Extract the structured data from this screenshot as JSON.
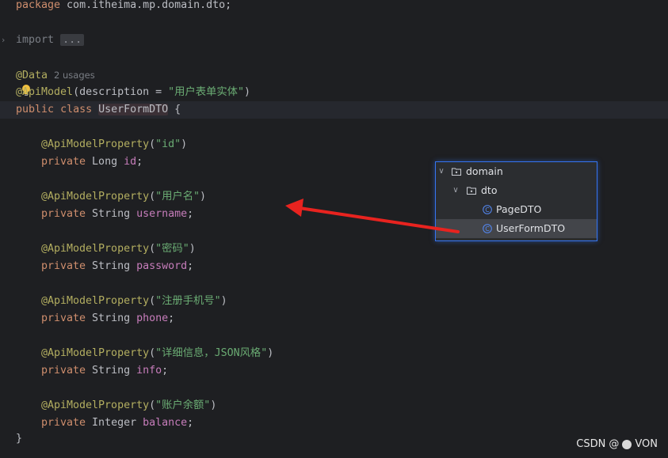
{
  "editor": {
    "package_kw": "package",
    "package_name": " com.itheima.mp.domain.dto;",
    "import_kw": "import",
    "import_fold": "...",
    "data_annotation": "@Data",
    "usages": "2 usages",
    "api_model_ann": "@ApiModel",
    "api_model_open": "(description = ",
    "api_model_value": "\"用户表单实体\"",
    "api_model_close": ")",
    "public_kw": "public",
    "class_kw": "class",
    "class_name": "UserFormDTO",
    "brace_open": " {",
    "brace_close": "}",
    "private_kw": "private",
    "prop_ann": "@ApiModelProperty",
    "fields": [
      {
        "desc": "\"id\"",
        "type": " Long ",
        "name": "id"
      },
      {
        "desc": "\"用户名\"",
        "type": " String ",
        "name": "username"
      },
      {
        "desc": "\"密码\"",
        "type": " String ",
        "name": "password"
      },
      {
        "desc": "\"注册手机号\"",
        "type": " String ",
        "name": "phone"
      },
      {
        "desc": "\"详细信息，JSON风格\"",
        "type": " String ",
        "name": "info"
      },
      {
        "desc": "\"账户余额\"",
        "type": " Integer ",
        "name": "balance"
      }
    ]
  },
  "tree_popup": {
    "items": [
      {
        "label": "domain",
        "icon": "folder-icon"
      },
      {
        "label": "dto",
        "icon": "folder-icon"
      },
      {
        "label": "PageDTO",
        "icon": "class-icon"
      },
      {
        "label": "UserFormDTO",
        "icon": "class-icon",
        "selected": true
      }
    ]
  },
  "watermark": {
    "left": "CSDN",
    "at": "@",
    "right": "VON"
  },
  "colors": {
    "background": "#1e1f22",
    "keyword": "#cf8e6d",
    "annotation": "#b3ae60",
    "string": "#6aab73",
    "field": "#c77dbb",
    "arrow": "#e8231f",
    "popup_border": "#3574f0"
  }
}
